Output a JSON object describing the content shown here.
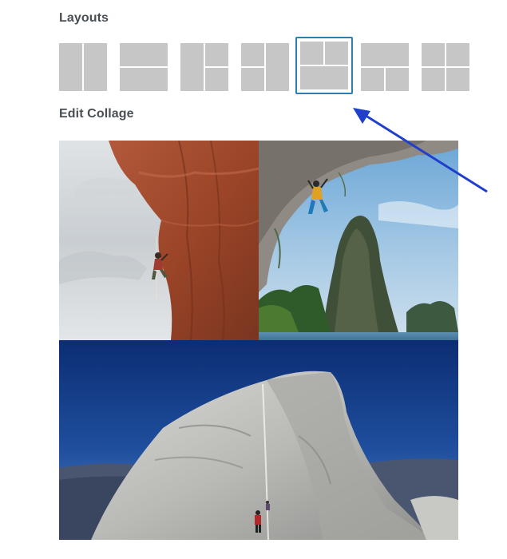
{
  "sections": {
    "layouts_title": "Layouts",
    "edit_collage_title": "Edit Collage"
  },
  "layouts": {
    "options": [
      {
        "name": "two-columns",
        "selected": false
      },
      {
        "name": "two-rows",
        "selected": false
      },
      {
        "name": "left-column-right-split",
        "selected": false
      },
      {
        "name": "left-split-right-column",
        "selected": false
      },
      {
        "name": "top-split-bottom-row",
        "selected": true
      },
      {
        "name": "top-row-bottom-split",
        "selected": false
      },
      {
        "name": "four-grid",
        "selected": false
      }
    ]
  },
  "collage": {
    "photos": [
      {
        "name": "cliff-climber-photo",
        "position": "top-left"
      },
      {
        "name": "overhang-climber-photo",
        "position": "top-right"
      },
      {
        "name": "half-dome-photo",
        "position": "bottom"
      }
    ]
  },
  "annotation": {
    "arrow_color": "#1f3fcc",
    "points_to": "selected-layout"
  },
  "colors": {
    "title_text": "#4a4f55",
    "layout_tile": "#c6c6c6",
    "selected_border": "#2d7fb3"
  }
}
